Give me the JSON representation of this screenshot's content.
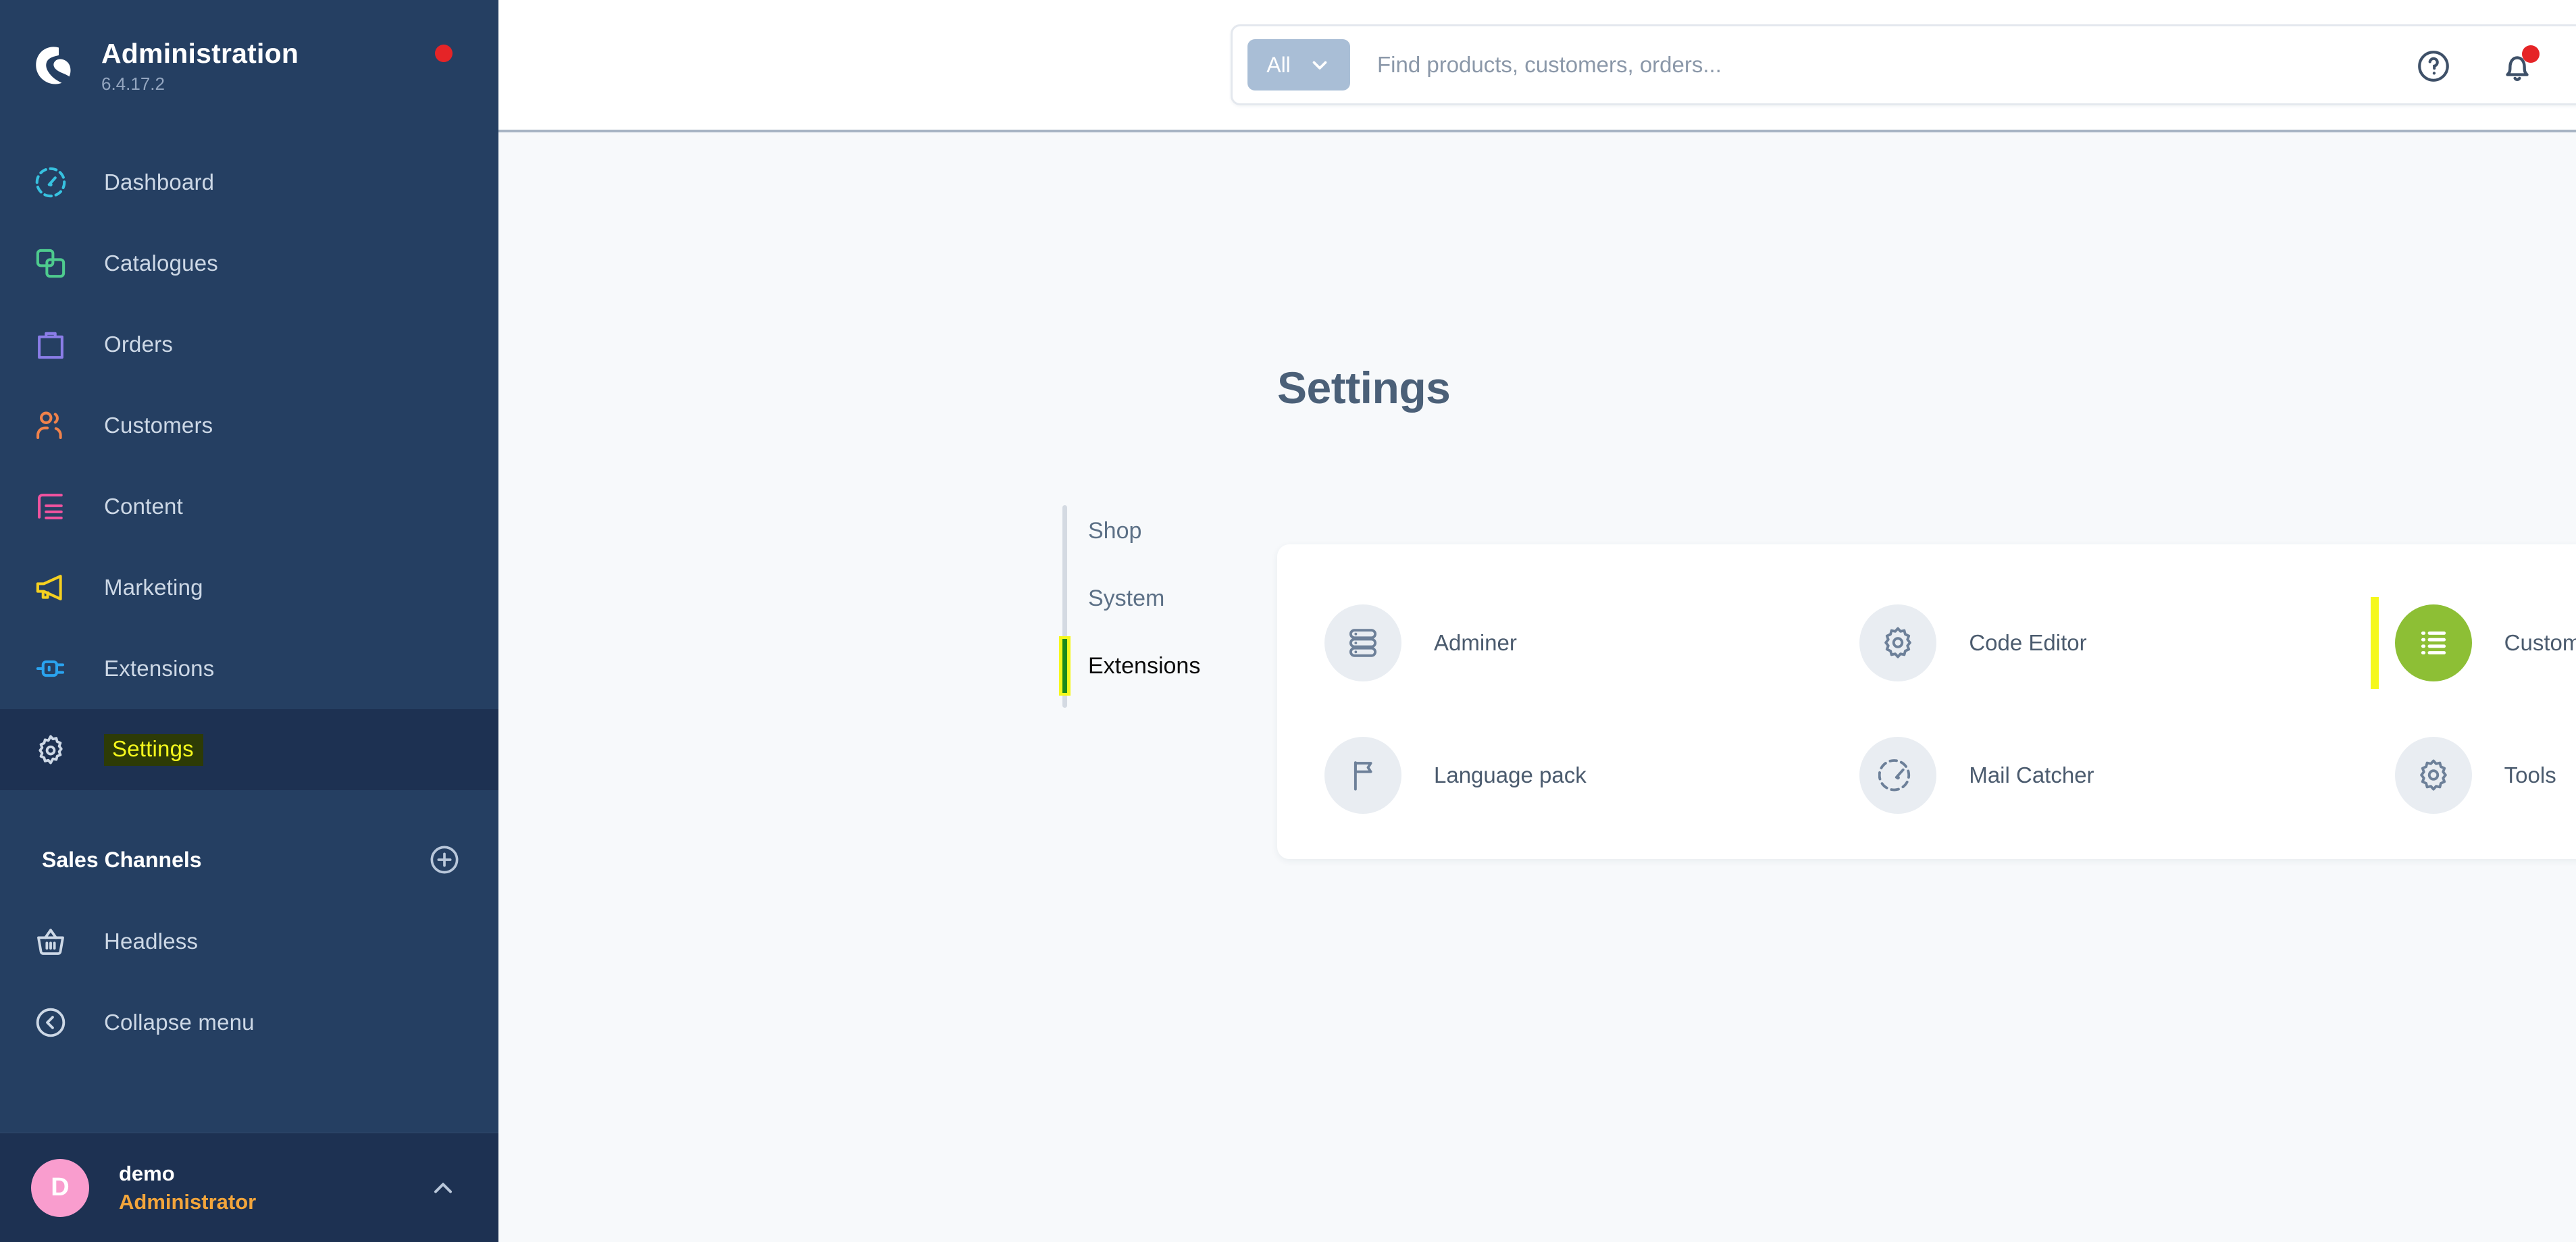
{
  "sidebar": {
    "brand": {
      "title": "Administration",
      "version": "6.4.17.2",
      "status_dot": "#e52427"
    },
    "items": [
      {
        "label": "Dashboard",
        "icon": "gauge-icon",
        "color": "#37c2e0",
        "active": false
      },
      {
        "label": "Catalogues",
        "icon": "copy-icon",
        "color": "#4ecb8e",
        "active": false
      },
      {
        "label": "Orders",
        "icon": "bag-icon",
        "color": "#8b7de8",
        "active": false
      },
      {
        "label": "Customers",
        "icon": "users-icon",
        "color": "#f0824b",
        "active": false
      },
      {
        "label": "Content",
        "icon": "content-icon",
        "color": "#f2539f",
        "active": false
      },
      {
        "label": "Marketing",
        "icon": "megaphone-icon",
        "color": "#f5d020",
        "active": false
      },
      {
        "label": "Extensions",
        "icon": "plug-icon",
        "color": "#2aa3ef",
        "active": false
      },
      {
        "label": "Settings",
        "icon": "gear-icon",
        "color": "#cdd8e6",
        "active": true,
        "highlighted": true
      }
    ],
    "section": {
      "title": "Sales Channels",
      "add_icon": "plus-circle-icon"
    },
    "channels": [
      {
        "label": "Headless",
        "icon": "basket-icon"
      }
    ],
    "collapse": {
      "label": "Collapse menu",
      "icon": "chevron-left-circle-icon"
    },
    "user": {
      "initial": "D",
      "name": "demo",
      "role": "Administrator",
      "caret": "chevron-up-icon"
    }
  },
  "topbar": {
    "search": {
      "scope_label": "All",
      "scope_caret": "chevron-down-icon",
      "placeholder": "Find products, customers, orders...",
      "value": "",
      "submit_icon": "search-icon"
    },
    "actions": [
      {
        "name": "help-icon",
        "label": "?"
      },
      {
        "name": "notification-bell-icon",
        "has_badge": true
      }
    ]
  },
  "page": {
    "title": "Settings",
    "tabs": [
      {
        "label": "Shop",
        "active": false
      },
      {
        "label": "System",
        "active": false
      },
      {
        "label": "Extensions",
        "active": true
      }
    ],
    "extensions": [
      {
        "label": "Adminer",
        "icon": "database-icon",
        "highlighted": false
      },
      {
        "label": "Code Editor",
        "icon": "gear-icon",
        "highlighted": false
      },
      {
        "label": "Custom Order Fields",
        "icon": "list-icon",
        "highlighted": true,
        "badge_color": "#8dbf35"
      },
      {
        "label": "Language pack",
        "icon": "flag-icon",
        "highlighted": false
      },
      {
        "label": "Mail Catcher",
        "icon": "gauge-icon",
        "highlighted": false
      },
      {
        "label": "Tools",
        "icon": "gear-icon",
        "highlighted": false
      }
    ]
  },
  "colors": {
    "sidebar_bg": "#253f62",
    "sidebar_active": "#1d3152",
    "content_bg": "#f7f9fb",
    "accent_highlight": "#f5f81c",
    "accent_green": "#8dbf35",
    "text_heading": "#4b6078"
  }
}
